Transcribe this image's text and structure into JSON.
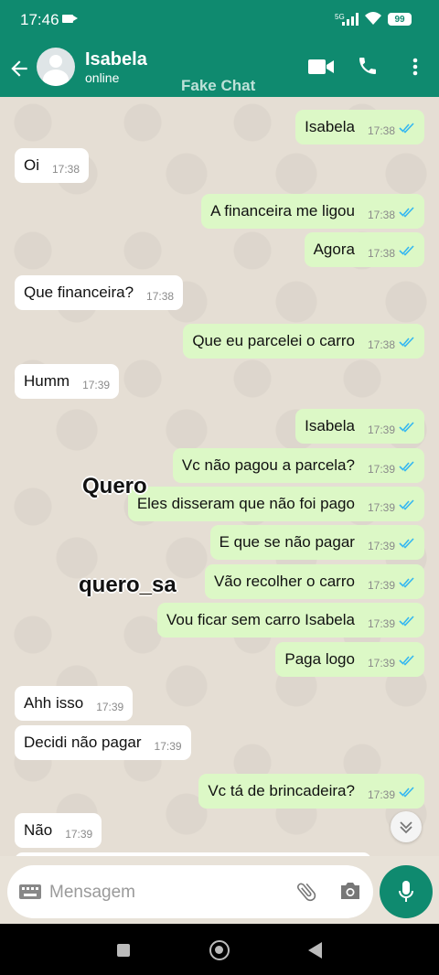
{
  "status_bar": {
    "time": "17:46",
    "network": "5G",
    "battery": "99"
  },
  "header": {
    "contact_name": "Isabela",
    "contact_status": "online",
    "watermark": "Fake Chat"
  },
  "messages": [
    {
      "dir": "out",
      "text": "Isabela",
      "time": "17:38"
    },
    {
      "dir": "in",
      "text": "Oi",
      "time": "17:38"
    },
    {
      "dir": "out",
      "text": "A financeira me ligou",
      "time": "17:38"
    },
    {
      "dir": "out",
      "text": "Agora",
      "time": "17:38"
    },
    {
      "dir": "in",
      "text": "Que financeira?",
      "time": "17:38"
    },
    {
      "dir": "out",
      "text": "Que eu parcelei o carro",
      "time": "17:38"
    },
    {
      "dir": "in",
      "text": "Humm",
      "time": "17:39"
    },
    {
      "dir": "out",
      "text": "Isabela",
      "time": "17:39"
    },
    {
      "dir": "out",
      "text": "Vc não pagou a parcela?",
      "time": "17:39"
    },
    {
      "dir": "out",
      "text": "Eles disseram que não foi pago",
      "time": "17:39"
    },
    {
      "dir": "out",
      "text": "E que se não pagar",
      "time": "17:39"
    },
    {
      "dir": "out",
      "text": "Vão recolher o carro",
      "time": "17:39"
    },
    {
      "dir": "out",
      "text": "Vou ficar sem carro Isabela",
      "time": "17:39"
    },
    {
      "dir": "out",
      "text": "Paga logo",
      "time": "17:39"
    },
    {
      "dir": "in",
      "text": "Ahh isso",
      "time": "17:39"
    },
    {
      "dir": "in",
      "text": "Decidi não pagar",
      "time": "17:39"
    },
    {
      "dir": "out",
      "text": "Vc tá de brincadeira?",
      "time": "17:39"
    },
    {
      "dir": "in",
      "text": "Não",
      "time": "17:39"
    }
  ],
  "overlays": {
    "text1": "Quero",
    "text2": "quero_sa"
  },
  "composer": {
    "placeholder": "Mensagem"
  },
  "colors": {
    "accent": "#0f8a6f",
    "outgoing_bubble": "#dcf8c6",
    "incoming_bubble": "#ffffff",
    "read_ticks": "#34b7f1"
  }
}
